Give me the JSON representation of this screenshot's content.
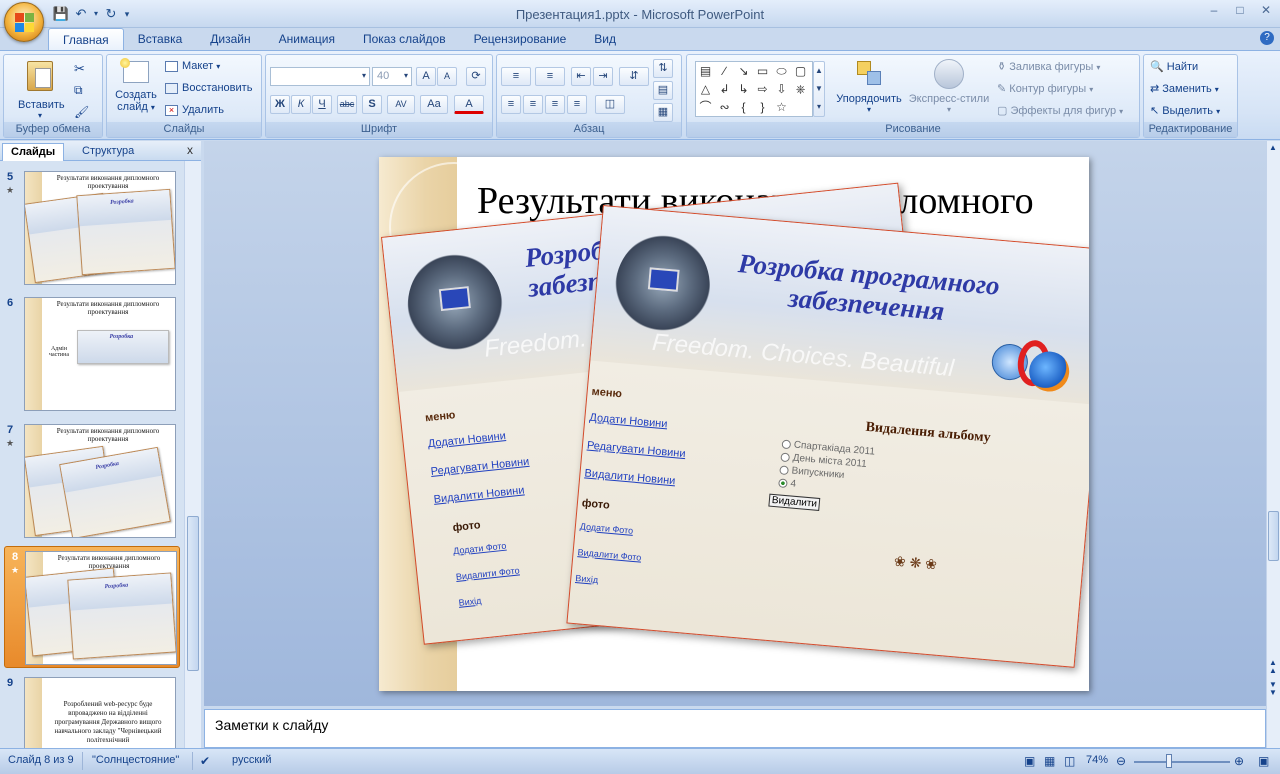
{
  "window": {
    "title": "Презентация1.pptx - Microsoft PowerPoint",
    "controls": [
      "–",
      "□",
      "✕"
    ]
  },
  "ribbon_tabs": [
    "Главная",
    "Вставка",
    "Дизайн",
    "Анимация",
    "Показ слайдов",
    "Рецензирование",
    "Вид"
  ],
  "active_tab": "Главная",
  "ribbon": {
    "clipboard": {
      "label": "Буфер обмена",
      "paste": "Вставить"
    },
    "slides": {
      "label": "Слайды",
      "new_slide_1": "Создать",
      "new_slide_2": "слайд",
      "layout": "Макет",
      "reset": "Восстановить",
      "delete": "Удалить"
    },
    "font": {
      "label": "Шрифт",
      "font_name": "",
      "font_size": "40",
      "bold": "Ж",
      "italic": "К",
      "underline": "Ч",
      "strike": "abc",
      "shadow": "S",
      "spacing": "AV",
      "case": "Aa",
      "color": "A",
      "grow": "A",
      "shrink": "A"
    },
    "paragraph": {
      "label": "Абзац"
    },
    "drawing": {
      "label": "Рисование",
      "arrange": "Упорядочить",
      "quick_styles": "Экспресс-стили",
      "fill": "Заливка фигуры",
      "outline": "Контур фигуры",
      "effects": "Эффекты для фигур"
    },
    "editing": {
      "label": "Редактирование",
      "find": "Найти",
      "replace": "Заменить",
      "select": "Выделить"
    }
  },
  "left_pane": {
    "tabs": [
      "Слайды",
      "Структура"
    ],
    "close": "x",
    "thumbnails": [
      {
        "num": "5",
        "title": "Результати виконання дипломного проектування",
        "selected": false
      },
      {
        "num": "6",
        "title": "Результати виконання дипломного проектування",
        "side": "Адмін частина",
        "selected": false
      },
      {
        "num": "7",
        "title": "Результати виконання дипломного проектування",
        "selected": false
      },
      {
        "num": "8",
        "title": "Результати виконання дипломного проектування",
        "selected": true
      },
      {
        "num": "9",
        "title": "",
        "body": "Розроблений web-ресурс буде впроваджено на відділенні програмування Державного вищого навчального закладу \"Чернівецький політехнічний",
        "selected": false
      }
    ]
  },
  "slide": {
    "title": "Результати виконання дипломного",
    "screenshot": {
      "banner_title": "Розробка програмного забезпечення",
      "slogan": "Freedom. Choices. Beautiful",
      "menu_header": "меню",
      "menu_links": [
        "Додати Новини",
        "Редагувати Новини",
        "Видалити Новини"
      ],
      "photo_header": "фото",
      "photo_links": [
        "Додати Фото",
        "Видалити Фото",
        "Вихід"
      ],
      "delete_header": "Видалення альбому",
      "options": [
        "Спартакіада 2011",
        "День міста 2011",
        "Випускники",
        "4"
      ],
      "delete_button": "Видалити"
    }
  },
  "notes": {
    "placeholder": "Заметки к слайду"
  },
  "status_bar": {
    "slide_info": "Слайд 8 из 9",
    "theme": "\"Солнцестояние\"",
    "language": "русский",
    "zoom": "74%"
  }
}
